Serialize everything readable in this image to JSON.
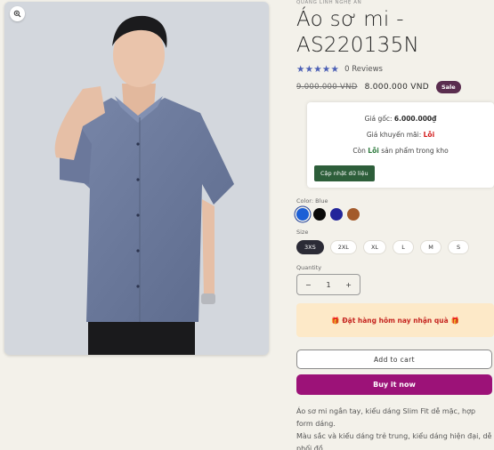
{
  "product": {
    "vendor": "QUANG LINH NGHỆ AN",
    "title": "Áo sơ mi - AS220135N",
    "stars": "★★★★★",
    "reviews": "0 Reviews",
    "price_old": "9.000.000 VND",
    "price_new": "8.000.000 VND",
    "sale_badge": "Sale"
  },
  "promo": {
    "original_label": "Giá gốc:",
    "original_value": "6.000.000₫",
    "promo_label": "Giá khuyến mãi:",
    "promo_value": "Lỗi",
    "stock_prefix": "Còn",
    "stock_value": "Lỗi",
    "stock_suffix": "sản phẩm trong kho",
    "update_button": "Cập nhật dữ liệu"
  },
  "options": {
    "color_label": "Color: Blue",
    "colors": [
      {
        "name": "Blue",
        "hex": "#1c5fd6",
        "selected": true
      },
      {
        "name": "Black",
        "hex": "#0a0a0a",
        "selected": false
      },
      {
        "name": "Navy",
        "hex": "#22259a",
        "selected": false
      },
      {
        "name": "Brown",
        "hex": "#a35a2b",
        "selected": false
      }
    ],
    "size_label": "Size",
    "sizes": [
      "3XS",
      "2XL",
      "XL",
      "L",
      "M",
      "S"
    ],
    "selected_size": "3XS",
    "quantity_label": "Quantity",
    "quantity_value": "1",
    "minus": "−",
    "plus": "+"
  },
  "gift_banner": {
    "icon": "🎁",
    "text": "Đặt hàng hôm nay nhận quà"
  },
  "buttons": {
    "add_to_cart": "Add to cart",
    "buy_now": "Buy it now"
  },
  "description": {
    "line1": "Áo sơ mi ngắn tay, kiểu dáng Slim Fit dễ mặc, hợp form dáng.",
    "line2": "Màu sắc và kiểu dáng trẻ trung, kiểu dáng hiện đại, dễ phối đồ."
  },
  "colors": {
    "accent": "#9c1278",
    "badge": "#5a2d4f",
    "update_btn": "#2d5e3a",
    "star": "#4b5fb5"
  }
}
